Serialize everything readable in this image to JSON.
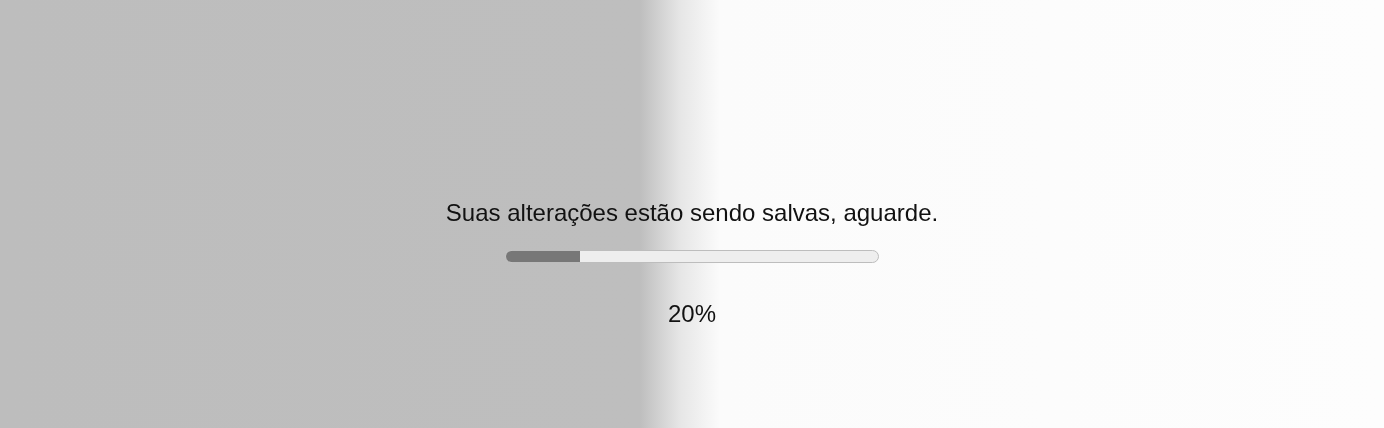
{
  "message": "Suas alterações estão sendo salvas, aguarde.",
  "progress": {
    "level": 0.2
  },
  "percent": "20%"
}
